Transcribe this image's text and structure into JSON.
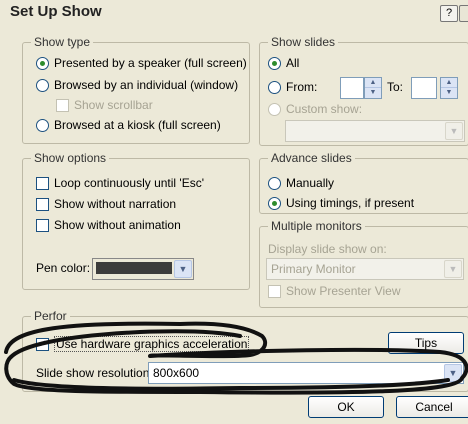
{
  "dialog": {
    "title": "Set Up Show",
    "help_label": "?"
  },
  "show_type": {
    "legend": "Show type",
    "presented_label": "Presented by a speaker (full screen)",
    "browsed_individual_label": "Browsed by an individual (window)",
    "show_scrollbar_label": "Show scrollbar",
    "browsed_kiosk_label": "Browsed at a kiosk (full screen)",
    "selected": "presented"
  },
  "show_slides": {
    "legend": "Show slides",
    "all_label": "All",
    "from_label": "From:",
    "to_label": "To:",
    "custom_show_label": "Custom show:",
    "selected": "all"
  },
  "show_options": {
    "legend": "Show options",
    "loop_label": "Loop continuously until 'Esc'",
    "no_narration_label": "Show without narration",
    "no_animation_label": "Show without animation",
    "pen_color_label": "Pen color:",
    "pen_color": "#3c3c3c"
  },
  "advance_slides": {
    "legend": "Advance slides",
    "manually_label": "Manually",
    "timings_label": "Using timings, if present",
    "selected": "timings"
  },
  "multiple_monitors": {
    "legend": "Multiple monitors",
    "display_on_label": "Display slide show on:",
    "monitor_value": "Primary Monitor",
    "presenter_view_label": "Show Presenter View"
  },
  "performance": {
    "legend": "Perfor",
    "hw_accel_label": "Use hardware graphics acceleration",
    "tips_label": "Tips",
    "resolution_label": "Slide show resolution:",
    "resolution_value": "800x600"
  },
  "buttons": {
    "ok_label": "OK",
    "cancel_label": "Cancel"
  },
  "colors": {
    "marker": "#111111",
    "accent": "#2d8c2d"
  }
}
